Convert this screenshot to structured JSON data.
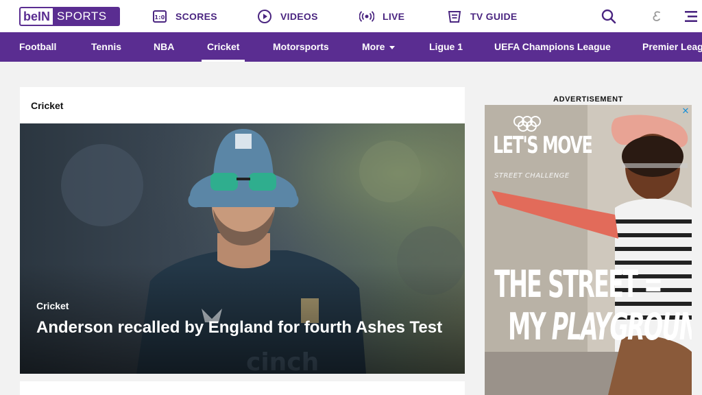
{
  "header": {
    "logo_left": "beIN",
    "logo_right": "SPORTS",
    "nav": [
      {
        "label": "SCORES",
        "icon": "scores-icon"
      },
      {
        "label": "VIDEOS",
        "icon": "play-icon"
      },
      {
        "label": "LIVE",
        "icon": "live-broadcast-icon"
      },
      {
        "label": "TV GUIDE",
        "icon": "tv-guide-icon"
      }
    ],
    "right_icons": [
      "search-icon",
      "language-icon",
      "menu-icon"
    ]
  },
  "sport_nav": {
    "items": [
      "Football",
      "Tennis",
      "NBA",
      "Cricket",
      "Motorsports",
      "More",
      "Ligue 1",
      "UEFA Champions League",
      "Premier League"
    ],
    "active": "Cricket"
  },
  "main": {
    "section_title": "Cricket",
    "featured": {
      "category": "Cricket",
      "headline": "Anderson recalled by England for fourth Ashes Test"
    }
  },
  "ad": {
    "label": "ADVERTISEMENT",
    "close": "✕",
    "line1": "LET'S MOVE",
    "line2": "STREET CHALLENGE",
    "line3": "THE STREET =",
    "line4_a": "MY ",
    "line4_b": "PLAYGROUND"
  },
  "colors": {
    "brand_purple": "#5a2d91",
    "nav_text": "#4a2580"
  }
}
